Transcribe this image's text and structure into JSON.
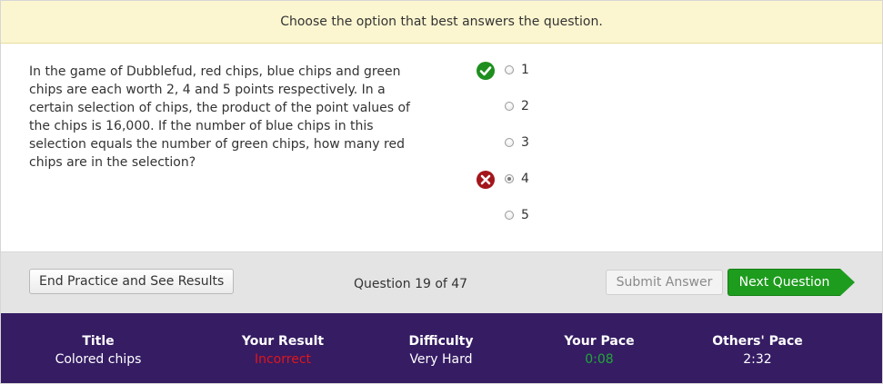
{
  "instruction": "Choose the option that best answers the question.",
  "question": "In the game of Dubblefud, red chips, blue chips and green chips are each worth 2, 4 and 5 points respectively. In a certain selection of chips, the product of the point values of the chips is 16,000. If the number of blue chips in this selection equals the number of green chips, how many red chips are in the selection?",
  "answers": [
    {
      "label": "1",
      "mark": "check-icon",
      "selected": false
    },
    {
      "label": "2",
      "mark": "",
      "selected": false
    },
    {
      "label": "3",
      "mark": "",
      "selected": false
    },
    {
      "label": "4",
      "mark": "x-icon",
      "selected": true
    },
    {
      "label": "5",
      "mark": "",
      "selected": false
    }
  ],
  "toolbar": {
    "end_label": "End Practice and See Results",
    "counter": "Question 19 of 47",
    "submit_label": "Submit Answer",
    "next_label": "Next Question"
  },
  "stats": {
    "title_head": "Title",
    "title_val": "Colored chips",
    "result_head": "Your Result",
    "result_val": "Incorrect",
    "difficulty_head": "Difficulty",
    "difficulty_val": "Very Hard",
    "pace_head": "Your Pace",
    "pace_val": "0:08",
    "others_head": "Others' Pace",
    "others_val": "2:32"
  },
  "colors": {
    "instruction_bg": "#fcf6d0",
    "next_button": "#1e9c1e",
    "stats_bar": "#351c63",
    "incorrect": "#e0161b",
    "pace": "#22a837"
  }
}
